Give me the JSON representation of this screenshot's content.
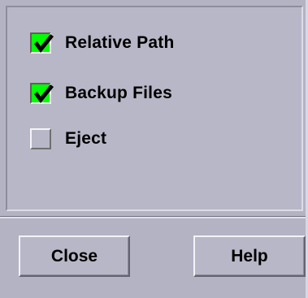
{
  "options": [
    {
      "label": "Relative Path",
      "checked": true
    },
    {
      "label": "Backup Files",
      "checked": true
    },
    {
      "label": "Eject",
      "checked": false
    }
  ],
  "buttons": {
    "close_label": "Close",
    "help_label": "Help"
  },
  "colors": {
    "background": "#b7b7c7",
    "checked_fill": "#00ff00",
    "text": "#000000"
  },
  "icons": {
    "check": "checkmark-icon"
  }
}
